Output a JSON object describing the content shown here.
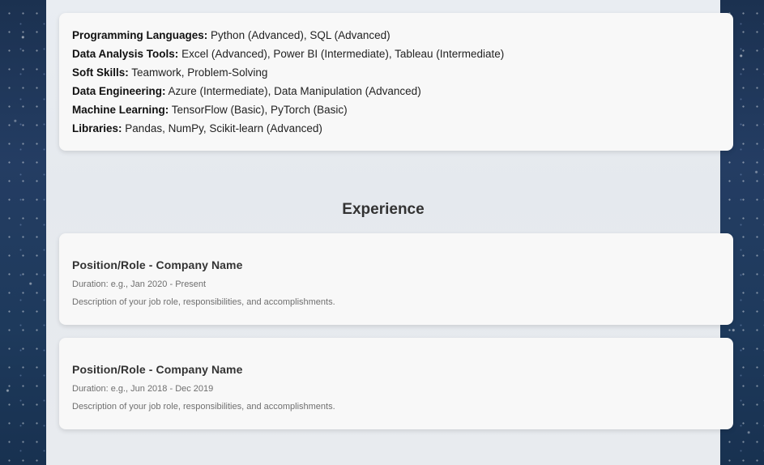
{
  "skills": [
    {
      "label": "Programming Languages:",
      "value": "Python (Advanced), SQL (Advanced)"
    },
    {
      "label": "Data Analysis Tools:",
      "value": "Excel (Advanced), Power BI (Intermediate), Tableau (Intermediate)"
    },
    {
      "label": "Soft Skills:",
      "value": "Teamwork, Problem-Solving"
    },
    {
      "label": "Data Engineering:",
      "value": "Azure (Intermediate), Data Manipulation (Advanced)"
    },
    {
      "label": "Machine Learning:",
      "value": "TensorFlow (Basic), PyTorch (Basic)"
    },
    {
      "label": "Libraries:",
      "value": "Pandas, NumPy, Scikit-learn (Advanced)"
    }
  ],
  "experience": {
    "heading": "Experience",
    "items": [
      {
        "title": "Position/Role - Company Name",
        "duration": "Duration: e.g., Jan 2020 - Present",
        "description": "Description of your job role, responsibilities, and accomplishments."
      },
      {
        "title": "Position/Role - Company Name",
        "duration": "Duration: e.g., Jun 2018 - Dec 2019",
        "description": "Description of your job role, responsibilities, and accomplishments."
      }
    ]
  },
  "colors": {
    "background": "#243d63",
    "page": "#e8ebef",
    "card": "#f8f8f8",
    "heading_text": "#333333",
    "muted_text": "#6f6f6f"
  }
}
